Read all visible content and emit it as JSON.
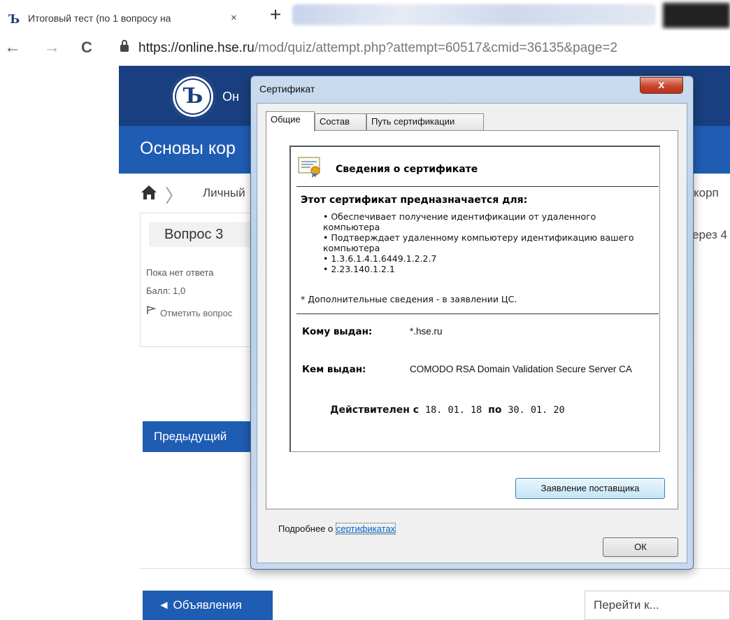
{
  "browser": {
    "tab": {
      "title": "Итоговый тест (по 1 вопросу на",
      "close": "×"
    },
    "new_tab": "+",
    "nav": {
      "back": "←",
      "forward": "→",
      "reload": "C"
    },
    "url": {
      "host": "https://online.hse.ru",
      "path": "/mod/quiz/attempt.php?attempt=60517&cmid=36135&page=2"
    }
  },
  "page": {
    "site_abbr": "Он",
    "course_title": "Основы кор",
    "breadcrumb": {
      "item": "Личный",
      "right": "корп"
    },
    "question": {
      "number": "Вопрос 3",
      "status": "Пока нет ответа",
      "grade": "Балл: 1,0",
      "flag_label": "Отметить вопрос"
    },
    "right_cut_text": "ерез 4",
    "prev_button": "Предыдущий",
    "announcements_button": "◄ Объявления",
    "goto_select": "Перейти к..."
  },
  "dialog": {
    "title": "Сертификат",
    "close": "x",
    "tabs": [
      "Общие",
      "Состав",
      "Путь сертификации"
    ],
    "active_tab": 0,
    "info_heading": "Сведения о сертификате",
    "purpose_heading": "Этот сертификат предназначается для:",
    "purposes": [
      "• Обеспечивает получение идентификации от удаленного компьютера",
      "• Подтверждает удаленному компьютеру идентификацию вашего компьютера",
      "• 1.3.6.1.4.1.6449.1.2.2.7",
      "• 2.23.140.1.2.1"
    ],
    "note": "* Дополнительные сведения - в заявлении ЦС.",
    "issued_to_label": "Кому выдан:",
    "issued_to": "*.hse.ru",
    "issued_by_label": "Кем выдан:",
    "issued_by": "COMODO RSA Domain Validation Secure Server CA",
    "valid_from_label": "Действителен с",
    "valid_from": "18. 01. 18",
    "valid_to_label": "по",
    "valid_to": "30. 01. 20",
    "issuer_statement_button": "Заявление поставщика",
    "more_prefix": "Подробнее о ",
    "more_link": "сертификатах",
    "ok_button": "ОК"
  }
}
